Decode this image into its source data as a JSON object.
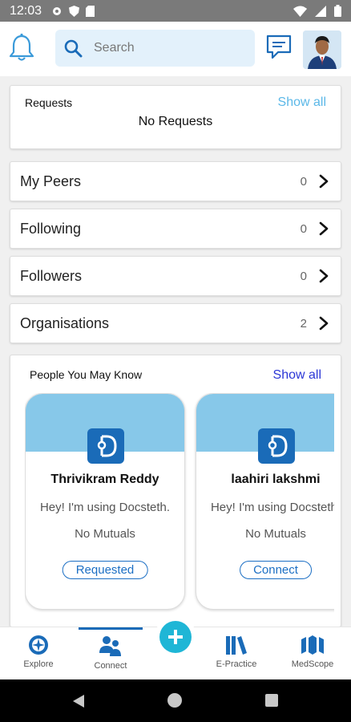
{
  "status_bar": {
    "time": "12:03"
  },
  "header": {
    "search_placeholder": "Search"
  },
  "requests": {
    "title": "Requests",
    "show_all": "Show all",
    "empty_text": "No Requests"
  },
  "network_rows": [
    {
      "label": "My Peers",
      "count": "0"
    },
    {
      "label": "Following",
      "count": "0"
    },
    {
      "label": "Followers",
      "count": "0"
    },
    {
      "label": "Organisations",
      "count": "2"
    }
  ],
  "people_you_may_know": {
    "title": "People You May Know",
    "show_all": "Show all",
    "people": [
      {
        "name": "Thrivikram Reddy",
        "status": "Hey! I'm using Docsteth.",
        "mutuals": "No Mutuals",
        "action": "Requested"
      },
      {
        "name": "laahiri lakshmi",
        "status": "Hey! I'm using Docsteth.",
        "mutuals": "No Mutuals",
        "action": "Connect"
      }
    ]
  },
  "bottom_nav": {
    "items": [
      {
        "label": "Explore"
      },
      {
        "label": "Connect",
        "active": true
      },
      {
        "label": "E-Practice"
      },
      {
        "label": "MedScope"
      }
    ]
  },
  "colors": {
    "accent": "#1a6bb8",
    "banner": "#87c8e9",
    "show_all_requests": "#5bb8e8",
    "show_all_people": "#2b36d6",
    "fab": "#1fb6d6"
  }
}
